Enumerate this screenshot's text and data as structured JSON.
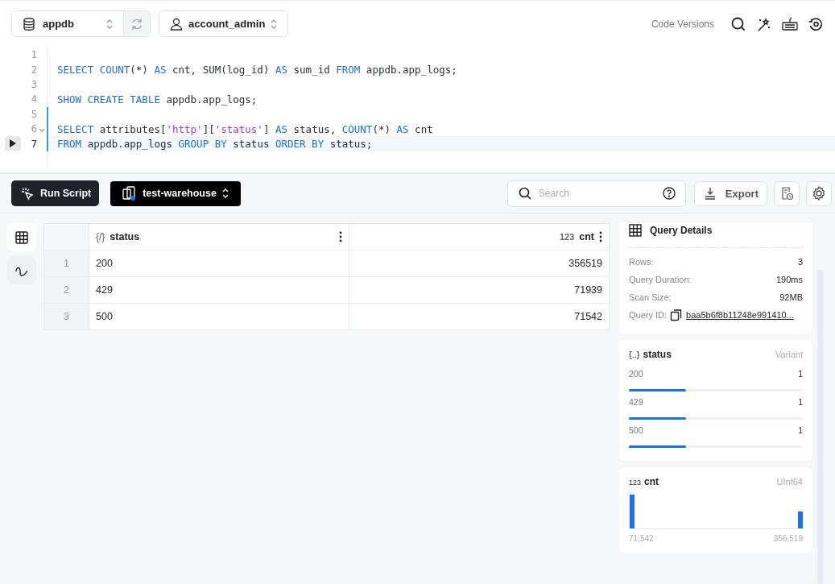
{
  "top_bar": {
    "database": "appdb",
    "role": "account_admin",
    "code_versions": "Code Versions"
  },
  "editor": {
    "lines": [
      {
        "number": "1",
        "foldable": false,
        "current": false
      },
      {
        "number": "2",
        "tokens": [
          {
            "text": "SELECT COUNT",
            "kind": "keyword"
          },
          {
            "text": "(*) ",
            "kind": "plain"
          },
          {
            "text": "AS",
            "kind": "keyword"
          },
          {
            "text": " cnt, SUM(log_id) ",
            "kind": "plain"
          },
          {
            "text": "AS",
            "kind": "keyword"
          },
          {
            "text": " sum_id ",
            "kind": "plain"
          },
          {
            "text": "FROM",
            "kind": "keyword"
          },
          {
            "text": " appdb.app_logs;",
            "kind": "plain"
          }
        ],
        "foldable": false,
        "current": false
      },
      {
        "number": "3",
        "foldable": false,
        "current": false
      },
      {
        "number": "4",
        "tokens": [
          {
            "text": "SHOW CREATE TABLE",
            "kind": "keyword"
          },
          {
            "text": " appdb.app_logs;",
            "kind": "plain"
          }
        ],
        "foldable": false,
        "current": false
      },
      {
        "number": "5",
        "foldable": false,
        "current": false
      },
      {
        "number": "6",
        "tokens": [
          {
            "text": "SELECT",
            "kind": "keyword"
          },
          {
            "text": " attributes[",
            "kind": "plain"
          },
          {
            "text": "'http'",
            "kind": "string"
          },
          {
            "text": "][",
            "kind": "plain"
          },
          {
            "text": "'status'",
            "kind": "string"
          },
          {
            "text": "] ",
            "kind": "plain"
          },
          {
            "text": "AS",
            "kind": "keyword"
          },
          {
            "text": " status, ",
            "kind": "plain"
          },
          {
            "text": "COUNT",
            "kind": "keyword"
          },
          {
            "text": "(*) ",
            "kind": "plain"
          },
          {
            "text": "AS",
            "kind": "keyword"
          },
          {
            "text": " cnt",
            "kind": "plain"
          }
        ],
        "foldable": true,
        "current": false
      },
      {
        "number": "7",
        "tokens": [
          {
            "text": "FROM",
            "kind": "keyword"
          },
          {
            "text": " appdb.app_logs ",
            "kind": "plain"
          },
          {
            "text": "GROUP BY",
            "kind": "keyword"
          },
          {
            "text": " status ",
            "kind": "plain"
          },
          {
            "text": "ORDER BY",
            "kind": "keyword"
          },
          {
            "text": " status;",
            "kind": "plain"
          }
        ],
        "foldable": false,
        "current": true
      }
    ]
  },
  "toolbar": {
    "run_button": "Run Script",
    "warehouse": "test-warehouse",
    "search": {
      "placeholder": "Search"
    },
    "export_button": "Export"
  },
  "view_tabs": [
    {
      "kind": "table",
      "selected": true
    },
    {
      "kind": "chart",
      "selected": false
    }
  ],
  "table": {
    "columns": [
      {
        "type": "{/}",
        "name": "status",
        "kind": "text"
      },
      {
        "type": "123",
        "name": "cnt",
        "kind": "number"
      }
    ],
    "rows": [
      {
        "index": "1",
        "cells": [
          "200",
          "356519"
        ]
      },
      {
        "index": "2",
        "cells": [
          "429",
          "71939"
        ]
      },
      {
        "index": "3",
        "cells": [
          "500",
          "71542"
        ]
      }
    ]
  },
  "query_details": {
    "title": "Query Details",
    "items": [
      {
        "label": "Rows:",
        "value": "3"
      },
      {
        "label": "Query Duration:",
        "value": "190ms"
      },
      {
        "label": "Scan Size:",
        "value": "92MB"
      }
    ],
    "query_id_label": "Query ID:",
    "query_id": "baa5b6f8b11248e991410..."
  },
  "status_stats": {
    "type_icon": "{..}",
    "name": "status",
    "type": "Variant",
    "values": [
      {
        "label": "200",
        "count": "1",
        "level": 0.33
      },
      {
        "label": "429",
        "count": "1",
        "level": 0.33
      },
      {
        "label": "500",
        "count": "1",
        "level": 0.33
      }
    ]
  },
  "cnt_stats": {
    "type_icon": "123",
    "name": "cnt",
    "type": "UInt64",
    "range_min": "71,542",
    "range_max": "356,519"
  }
}
